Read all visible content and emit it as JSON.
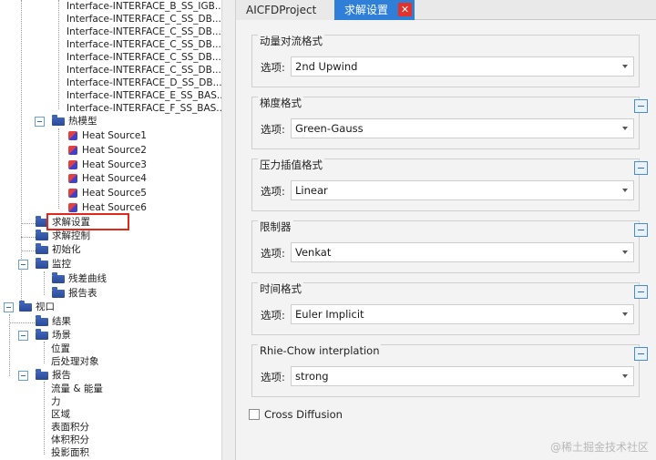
{
  "tree": {
    "interfaces": [
      "Interface-INTERFACE_B_SS_IGB...",
      "Interface-INTERFACE_C_SS_DB...",
      "Interface-INTERFACE_C_SS_DB...",
      "Interface-INTERFACE_C_SS_DB...",
      "Interface-INTERFACE_C_SS_DB...",
      "Interface-INTERFACE_C_SS_DB...",
      "Interface-INTERFACE_D_SS_DB...",
      "Interface-INTERFACE_E_SS_BAS...",
      "Interface-INTERFACE_F_SS_BAS..."
    ],
    "thermal_model": "热模型",
    "heat_sources": [
      "Heat Source1",
      "Heat Source2",
      "Heat Source3",
      "Heat Source4",
      "Heat Source5",
      "Heat Source6"
    ],
    "solver_settings": "求解设置",
    "solver_control": "求解控制",
    "initialization": "初始化",
    "monitor": "监控",
    "residual_curve": "残差曲线",
    "report_table": "报告表",
    "viewport": "视口",
    "results": "结果",
    "scene": "场景",
    "position": "位置",
    "post_objects": "后处理对象",
    "report": "报告",
    "report_items": [
      "流量 & 能量",
      "力",
      "区域",
      "表面积分",
      "体积积分",
      "投影面积"
    ]
  },
  "tabs": {
    "project": "AICFDProject",
    "solver": "求解设置",
    "close": "✕"
  },
  "groups": [
    {
      "title": "动量对流格式",
      "label": "选项:",
      "value": "2nd Upwind"
    },
    {
      "title": "梯度格式",
      "label": "选项:",
      "value": "Green-Gauss"
    },
    {
      "title": "压力插值格式",
      "label": "选项:",
      "value": "Linear"
    },
    {
      "title": "限制器",
      "label": "选项:",
      "value": "Venkat"
    },
    {
      "title": "时间格式",
      "label": "选项:",
      "value": "Euler Implicit"
    },
    {
      "title": "Rhie-Chow interplation",
      "label": "选项:",
      "value": "strong"
    }
  ],
  "cross_diffusion": {
    "label": "Cross Diffusion",
    "checked": false
  },
  "watermark": "@稀土掘金技术社区",
  "colors": {
    "accent_tab": "#2f7fd9",
    "close_button": "#e2322b",
    "highlight_box": "#e3261c",
    "folder": "#3f63b8"
  }
}
